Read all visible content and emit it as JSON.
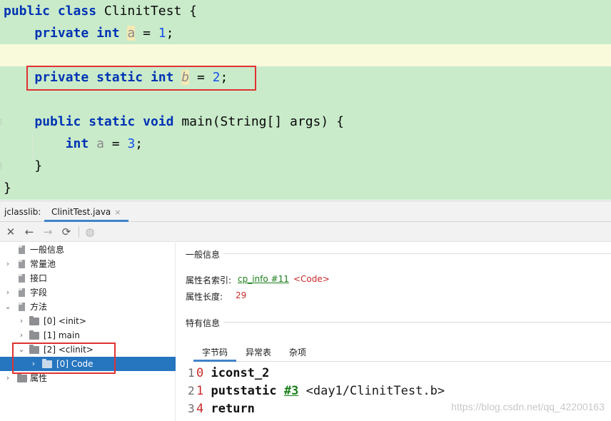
{
  "colors": {
    "editor_bg": "#c9ebca",
    "current_line_bg": "#f8fadb",
    "keyword": "#0033b3",
    "number": "#1750eb",
    "selection": "#2675bf",
    "annotation_red": "#e03131",
    "link_green": "#1a7f1a"
  },
  "editor": {
    "lines": [
      {
        "kw1": "public",
        "kw2": "class",
        "name": "ClinitTest",
        "brace": "{"
      },
      {
        "kw1": "private",
        "kw2": "int",
        "var": "a",
        "eq": "=",
        "num": "1",
        "semi": ";"
      },
      {
        "text": ""
      },
      {
        "kw1": "private",
        "kw2": "static",
        "kw3": "int",
        "var": "b",
        "eq": "=",
        "num": "2",
        "semi": ";"
      },
      {
        "text": ""
      },
      {
        "kw1": "public",
        "kw2": "static",
        "kw3": "void",
        "sig": "main(String[] args)",
        "brace": "{"
      },
      {
        "kw1": "int",
        "var": "a",
        "eq": "=",
        "num": "3",
        "semi": ";"
      },
      {
        "brace": "}"
      },
      {
        "brace": "}"
      }
    ]
  },
  "toolwindow": {
    "title": "jclasslib:",
    "tab_label": "ClinitTest.java",
    "tab_close": "×"
  },
  "toolbar": {
    "icons": [
      "close-icon",
      "back-arrow-icon",
      "forward-arrow-icon",
      "refresh-icon",
      "browser-globe-icon"
    ],
    "glyphs": [
      "✕",
      "←",
      "→",
      "⟳",
      "◍"
    ]
  },
  "tree": {
    "items": [
      {
        "chevron": "",
        "icon": "file-icon",
        "label": "一般信息"
      },
      {
        "chevron": "›",
        "icon": "file-icon",
        "label": "常量池"
      },
      {
        "chevron": "",
        "icon": "file-icon",
        "label": "接口"
      },
      {
        "chevron": "›",
        "icon": "file-icon",
        "label": "字段"
      },
      {
        "chevron": "⌄",
        "icon": "file-icon",
        "label": "方法"
      },
      {
        "chevron": "›",
        "icon": "folder-icon",
        "label": "[0] <init>"
      },
      {
        "chevron": "›",
        "icon": "folder-icon",
        "label": "[1] main"
      },
      {
        "chevron": "⌄",
        "icon": "folder-icon",
        "label": "[2] <clinit>"
      },
      {
        "chevron": "›",
        "icon": "folder-icon",
        "label": "[0] Code"
      },
      {
        "chevron": "›",
        "icon": "file-icon",
        "label": "属性"
      }
    ]
  },
  "detail": {
    "general_section": "一般信息",
    "attr_name_index_label": "属性名索引:",
    "attr_name_index_link": "cp_info #11",
    "attr_name_index_tag": "<Code>",
    "attr_length_label": "属性长度:",
    "attr_length_value": "29",
    "specific_section": "特有信息",
    "tabs": [
      "字节码",
      "异常表",
      "杂项"
    ],
    "bytecode": [
      {
        "line": "1",
        "offset": "0",
        "op": "iconst_2",
        "ref": "",
        "arg": ""
      },
      {
        "line": "2",
        "offset": "1",
        "op": "putstatic",
        "ref": "#3",
        "arg": "<day1/ClinitTest.b>"
      },
      {
        "line": "3",
        "offset": "4",
        "op": "return",
        "ref": "",
        "arg": ""
      }
    ]
  },
  "watermark": "https://blog.csdn.net/qq_42200163"
}
